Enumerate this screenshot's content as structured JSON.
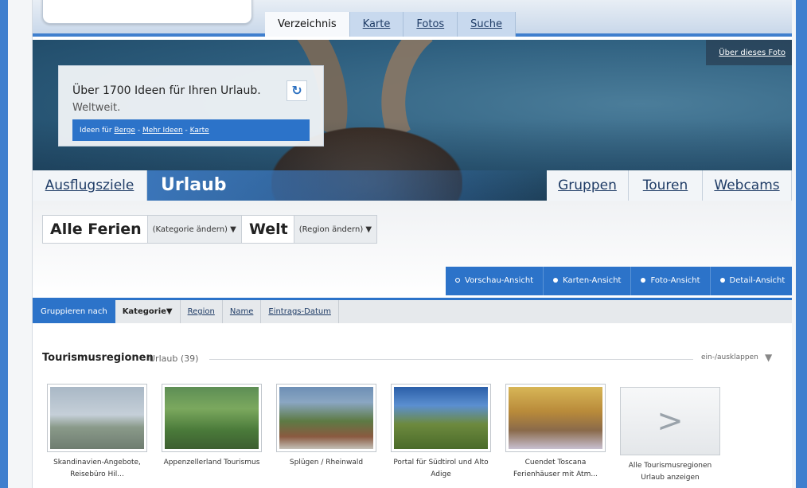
{
  "nav": {
    "tabs": [
      {
        "label": "Verzeichnis",
        "active": true
      },
      {
        "label": "Karte",
        "active": false
      },
      {
        "label": "Fotos",
        "active": false
      },
      {
        "label": "Suche",
        "active": false
      }
    ]
  },
  "hero": {
    "foto_link": "Über dieses Foto",
    "title": "Über 1700 Ideen für Ihren Urlaub.",
    "subtitle": "Weltweit.",
    "links_prefix": "Ideen für",
    "link_berge": "Berge",
    "sep1": " - ",
    "link_mehr": "Mehr Ideen",
    "sep2": " - ",
    "link_karte": "Karte"
  },
  "categories": {
    "left": "Ausflugsziele",
    "current": "Urlaub",
    "right": [
      "Gruppen",
      "Touren",
      "Webcams"
    ]
  },
  "filters": {
    "category_value": "Alle Ferien",
    "category_change": "(Kategorie ändern) ▼",
    "region_value": "Welt",
    "region_change": "(Region ändern) ▼"
  },
  "views": [
    {
      "label": "Vorschau-Ansicht",
      "active": true
    },
    {
      "label": "Karten-Ansicht",
      "active": false
    },
    {
      "label": "Foto-Ansicht",
      "active": false
    },
    {
      "label": "Detail-Ansicht",
      "active": false
    }
  ],
  "grouping": {
    "label": "Gruppieren nach",
    "items": [
      {
        "label": "Kategorie▼",
        "current": true
      },
      {
        "label": "Region",
        "current": false
      },
      {
        "label": "Name",
        "current": false
      },
      {
        "label": "Eintrags-Datum",
        "current": false
      }
    ]
  },
  "section": {
    "title": "Tourismusregionen",
    "count": "Urlaub (39)",
    "toggle": "ein-/ausklappen",
    "chevron": "chevron-down-icon"
  },
  "cards": [
    {
      "caption": "Skandinavien-Angebote, Reisebüro Hil..."
    },
    {
      "caption": "Appenzellerland Tourismus"
    },
    {
      "caption": "Splügen / Rheinwald"
    },
    {
      "caption": "Portal für Südtirol und Alto Adige"
    },
    {
      "caption": "Cuendet Toscana Ferienhäuser mit Atm..."
    },
    {
      "caption": "Alle Tourismusregionen Urlaub anzeigen"
    }
  ],
  "more_glyph": ">"
}
